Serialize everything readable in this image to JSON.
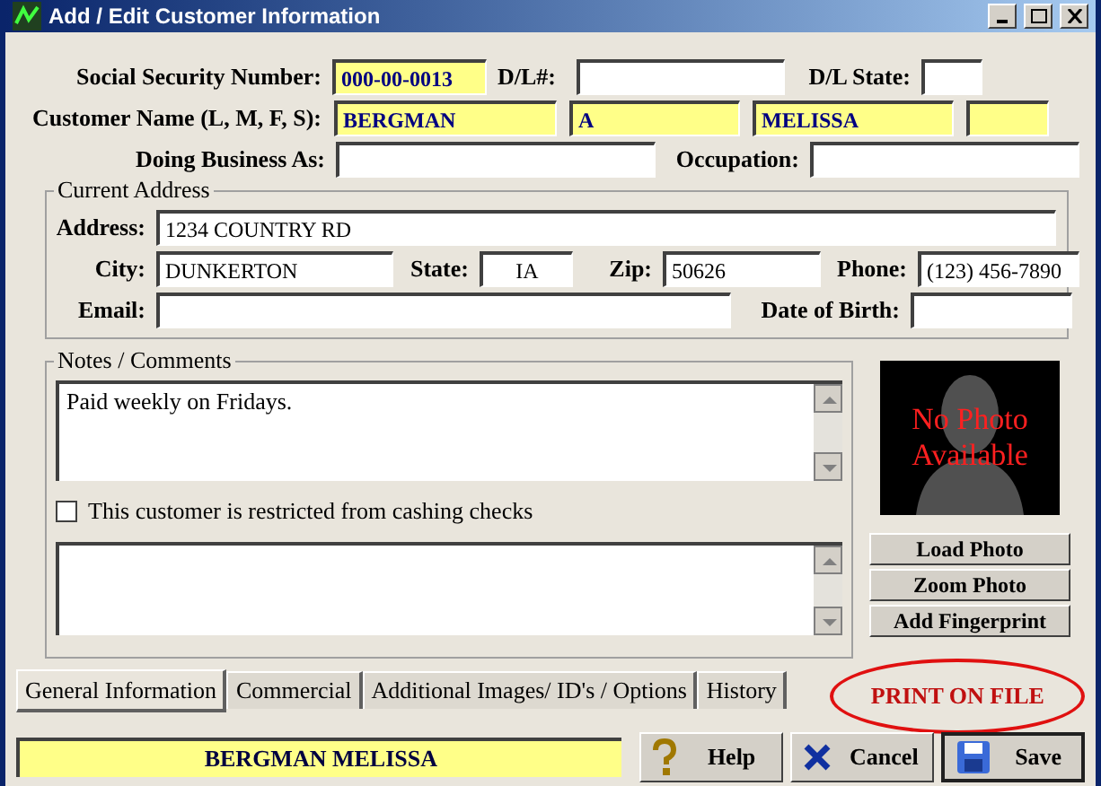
{
  "window": {
    "title": "Add / Edit Customer Information"
  },
  "identity": {
    "ssn_label": "Social Security Number:",
    "ssn": {
      "value": "000-00-0013",
      "highlighted": true
    },
    "dl_label": "D/L#:",
    "dl": {
      "highlighted": false
    },
    "dl_state_label": "D/L State:",
    "dl_state": {
      "highlighted": false
    },
    "name_label": "Customer Name (L, M, F, S):",
    "name_fields": [
      {
        "value": "BERGMAN",
        "highlighted": true
      },
      {
        "value": "A",
        "highlighted": true
      },
      {
        "value": "MELISSA",
        "highlighted": true
      },
      {
        "highlighted": true
      }
    ],
    "dba_label": "Doing Business As:",
    "dba": {
      "highlighted": false
    },
    "occupation_label": "Occupation:",
    "occupation": {
      "highlighted": false
    }
  },
  "address": {
    "legend": "Current Address",
    "address_label": "Address:",
    "address": "1234 COUNTRY RD",
    "city_label": "City:",
    "city": "DUNKERTON",
    "state_label": "State:",
    "state": "IA",
    "zip_label": "Zip:",
    "zip": "50626",
    "phone_label": "Phone:",
    "phone": "(123) 456-7890",
    "email_label": "Email:",
    "dob_label": "Date of Birth:"
  },
  "notes": {
    "legend": "Notes / Comments",
    "text": "Paid weekly on Fridays.",
    "restricted": {
      "label": "This customer is restricted from cashing checks",
      "checked": false
    }
  },
  "photo": {
    "caption": "No Photo Available"
  },
  "photo_buttons": [
    "Load Photo",
    "Zoom Photo",
    "Add Fingerprint"
  ],
  "tabs": [
    {
      "label": "General Information",
      "selected": true
    },
    {
      "label": "Commercial",
      "selected": false
    },
    {
      "label": "Additional Images/ ID's / Options",
      "selected": false
    },
    {
      "label": "History",
      "selected": false
    }
  ],
  "print_status": "PRINT ON FILE",
  "footer": {
    "customer": "BERGMAN MELISSA",
    "buttons": [
      {
        "kind": "help",
        "label": "Help"
      },
      {
        "kind": "cancel",
        "label": "Cancel"
      },
      {
        "kind": "save",
        "label": "Save"
      }
    ]
  }
}
